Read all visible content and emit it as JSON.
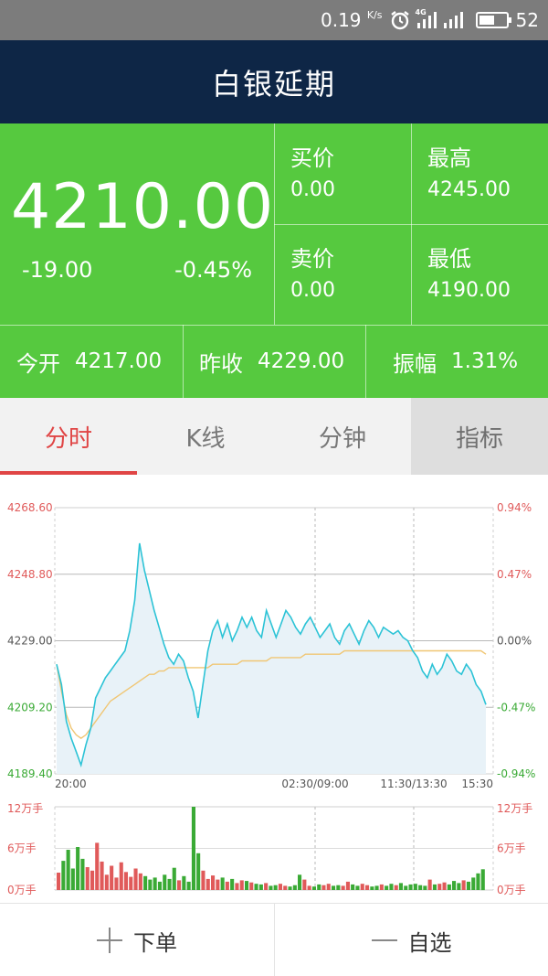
{
  "status_bar": {
    "speed": "0.19",
    "speed_unit": "K/s",
    "network": "4G",
    "battery": "52",
    "icons": [
      "alarm-clock-icon",
      "signal-4g-icon",
      "signal-icon",
      "battery-icon"
    ]
  },
  "title": "白银延期",
  "quote": {
    "price": "4210.00",
    "change": "-19.00",
    "change_pct": "-0.45%",
    "bid_label": "买价",
    "bid_value": "0.00",
    "high_label": "最高",
    "high_value": "4245.00",
    "ask_label": "卖价",
    "ask_value": "0.00",
    "low_label": "最低",
    "low_value": "4190.00",
    "open_label": "今开",
    "open_value": "4217.00",
    "prev_close_label": "昨收",
    "prev_close_value": "4229.00",
    "amplitude_label": "振幅",
    "amplitude_value": "1.31%"
  },
  "tabs": [
    {
      "label": "分时",
      "active": true
    },
    {
      "label": "K线",
      "active": false
    },
    {
      "label": "分钟",
      "active": false
    },
    {
      "label": "指标",
      "active": false
    }
  ],
  "colors": {
    "up": "#e05a5a",
    "down": "#3aaa35",
    "price_line": "#2cc3d6",
    "avg_line": "#f0c674",
    "area_fill": "#e8f2f8",
    "header_bg": "#0e2646",
    "quote_bg": "#56c93f"
  },
  "chart_data": {
    "type": "line",
    "price_axis": {
      "ticks": [
        "4268.60",
        "4248.80",
        "4229.00",
        "4209.20",
        "4189.40"
      ],
      "values": [
        4268.6,
        4248.8,
        4229.0,
        4209.2,
        4189.4
      ],
      "ylim": [
        4189.4,
        4268.6
      ]
    },
    "pct_axis": {
      "ticks": [
        "0.94%",
        "0.47%",
        "0.00%",
        "-0.47%",
        "-0.94%"
      ]
    },
    "time_labels": [
      "20:00",
      "02:30/09:00",
      "11:30/13:30",
      "15:30"
    ],
    "price_series": [
      4222,
      4216,
      4205,
      4200,
      4196,
      4192,
      4198,
      4203,
      4212,
      4215,
      4218,
      4220,
      4222,
      4224,
      4226,
      4232,
      4241,
      4258,
      4250,
      4244,
      4238,
      4233,
      4228,
      4224,
      4222,
      4225,
      4223,
      4218,
      4214,
      4206,
      4216,
      4226,
      4232,
      4235,
      4230,
      4234,
      4229,
      4232,
      4236,
      4233,
      4236,
      4232,
      4230,
      4238,
      4234,
      4230,
      4234,
      4238,
      4236,
      4233,
      4231,
      4234,
      4236,
      4233,
      4230,
      4232,
      4234,
      4230,
      4228,
      4232,
      4234,
      4231,
      4228,
      4232,
      4235,
      4233,
      4230,
      4233,
      4232,
      4231,
      4232,
      4230,
      4229,
      4226,
      4224,
      4220,
      4218,
      4222,
      4219,
      4221,
      4225,
      4223,
      4220,
      4219,
      4222,
      4220,
      4216,
      4214,
      4210
    ],
    "avg_series": [
      4222,
      4214,
      4207,
      4203,
      4201,
      4200,
      4201,
      4203,
      4205,
      4207,
      4209,
      4211,
      4212,
      4213,
      4214,
      4215,
      4216,
      4217,
      4218,
      4219,
      4219,
      4220,
      4220,
      4221,
      4221,
      4221,
      4221,
      4221,
      4221,
      4221,
      4221,
      4221,
      4222,
      4222,
      4222,
      4222,
      4222,
      4222,
      4223,
      4223,
      4223,
      4223,
      4223,
      4223,
      4224,
      4224,
      4224,
      4224,
      4224,
      4224,
      4224,
      4225,
      4225,
      4225,
      4225,
      4225,
      4225,
      4225,
      4225,
      4226,
      4226,
      4226,
      4226,
      4226,
      4226,
      4226,
      4226,
      4226,
      4226,
      4226,
      4226,
      4226,
      4226,
      4226,
      4226,
      4226,
      4226,
      4226,
      4226,
      4226,
      4226,
      4226,
      4226,
      4226,
      4226,
      4226,
      4226,
      4226,
      4225
    ],
    "volume_axis": {
      "ticks": [
        "12万手",
        "6万手",
        "0万手"
      ],
      "values": [
        12,
        6,
        0
      ],
      "unit": "万手"
    },
    "volume_series": [
      2.5,
      4.2,
      5.8,
      3.1,
      6.2,
      4.5,
      3.3,
      2.8,
      6.8,
      4.1,
      2.2,
      3.5,
      1.8,
      4.0,
      2.6,
      1.9,
      3.1,
      2.4,
      2.0,
      1.5,
      1.8,
      1.2,
      2.2,
      1.6,
      3.2,
      1.4,
      2.0,
      1.2,
      12.0,
      5.3,
      2.8,
      1.6,
      2.1,
      1.5,
      1.8,
      1.2,
      1.6,
      1.0,
      1.4,
      1.3,
      1.1,
      0.9,
      0.8,
      1.0,
      0.6,
      0.7,
      0.9,
      0.6,
      0.5,
      0.7,
      2.2,
      1.5,
      0.6,
      0.5,
      0.8,
      0.7,
      0.9,
      0.6,
      0.7,
      0.6,
      1.2,
      0.8,
      0.6,
      0.9,
      0.7,
      0.5,
      0.6,
      0.8,
      0.6,
      0.9,
      0.7,
      1.0,
      0.6,
      0.8,
      0.9,
      0.7,
      0.6,
      1.5,
      0.8,
      0.9,
      1.1,
      0.8,
      1.3,
      1.0,
      1.4,
      1.2,
      1.8,
      2.4,
      3.0
    ]
  },
  "bottom_bar": {
    "order_label": "下单",
    "watchlist_label": "自选"
  }
}
